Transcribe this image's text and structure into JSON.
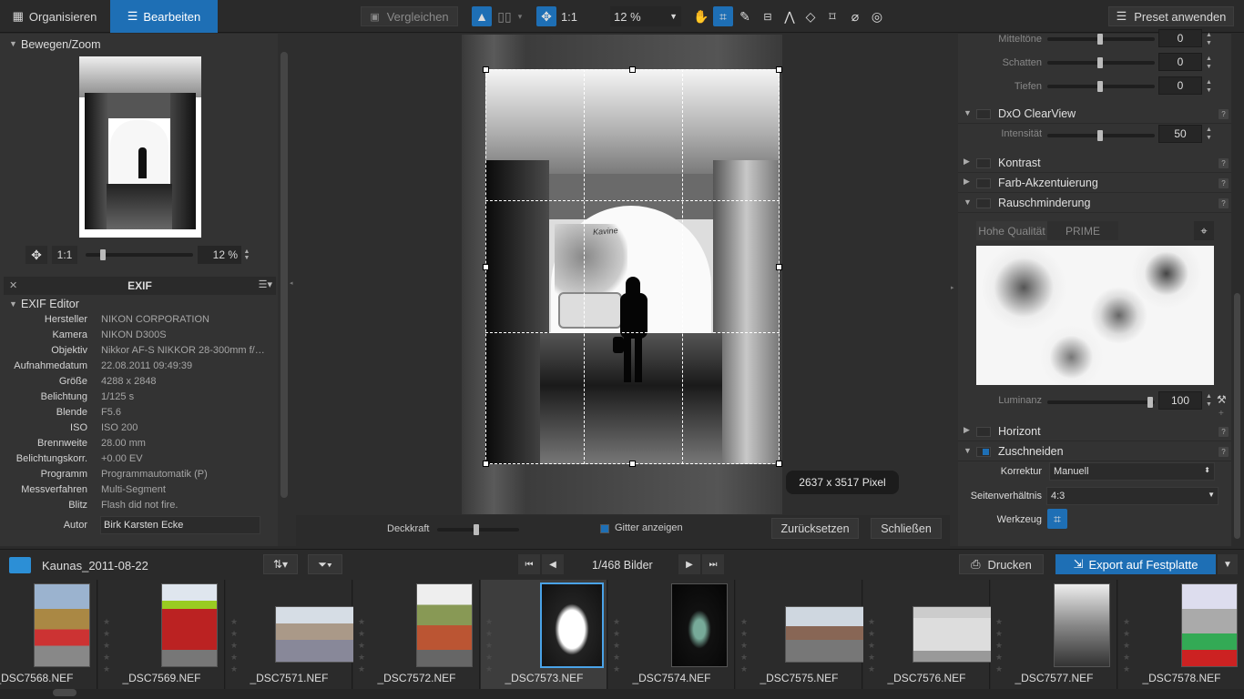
{
  "topbar": {
    "tab_organize": "Organisieren",
    "tab_edit": "Bearbeiten",
    "compare": "Vergleichen",
    "fit_label": "1:1",
    "zoom": "12 %",
    "preset": "Preset anwenden"
  },
  "left": {
    "navigator_title": "Bewegen/Zoom",
    "nav_fit": "1:1",
    "nav_zoom": "12 %",
    "exif_header": "EXIF",
    "exif_editor": "EXIF Editor",
    "exif": [
      {
        "k": "Hersteller",
        "v": "NIKON CORPORATION"
      },
      {
        "k": "Kamera",
        "v": "NIKON D300S"
      },
      {
        "k": "Objektiv",
        "v": "Nikkor AF-S NIKKOR 28-300mm f/…"
      },
      {
        "k": "Aufnahmedatum",
        "v": "22.08.2011 09:49:39"
      },
      {
        "k": "Größe",
        "v": "4288 x 2848"
      },
      {
        "k": "Belichtung",
        "v": "1/125 s"
      },
      {
        "k": "Blende",
        "v": "F5.6"
      },
      {
        "k": "ISO",
        "v": "ISO 200"
      },
      {
        "k": "Brennweite",
        "v": "28.00 mm"
      },
      {
        "k": "Belichtungskorr.",
        "v": "+0.00 EV"
      },
      {
        "k": "Programm",
        "v": "Programmautomatik (P)"
      },
      {
        "k": "Messverfahren",
        "v": "Multi-Segment"
      },
      {
        "k": "Blitz",
        "v": "Flash did not fire."
      }
    ],
    "author_label": "Autor",
    "author_value": "Birk Karsten Ecke"
  },
  "center": {
    "size_tooltip": "2637 x 3517 Pixel",
    "opacity_label": "Deckkraft",
    "grid_label": "Gitter anzeigen",
    "reset": "Zurücksetzen",
    "close": "Schließen",
    "photo_text": "Kavine"
  },
  "right": {
    "tone_rows": [
      {
        "label": "Mitteltöne",
        "value": "0"
      },
      {
        "label": "Schatten",
        "value": "0"
      },
      {
        "label": "Tiefen",
        "value": "0"
      }
    ],
    "clearview": "DxO ClearView",
    "intensity_label": "Intensität",
    "intensity_value": "50",
    "contrast": "Kontrast",
    "color_accent": "Farb-Akzentuierung",
    "noise": "Rauschminderung",
    "quality_high": "Hohe Qualität",
    "quality_prime": "PRIME",
    "luminance_label": "Luminanz",
    "luminance_value": "100",
    "horizon": "Horizont",
    "crop": "Zuschneiden",
    "correction_label": "Korrektur",
    "correction_value": "Manuell",
    "ratio_label": "Seitenverhältnis",
    "ratio_value": "4:3",
    "tool_label": "Werkzeug"
  },
  "bottom": {
    "folder": "Kaunas_2011-08-22",
    "counter": "1/468 Bilder",
    "print": "Drucken",
    "export": "Export auf Festplatte"
  },
  "filmstrip": [
    {
      "name": "_DSC7568.NEF"
    },
    {
      "name": "_DSC7569.NEF"
    },
    {
      "name": "_DSC7571.NEF"
    },
    {
      "name": "_DSC7572.NEF"
    },
    {
      "name": "_DSC7573.NEF"
    },
    {
      "name": "_DSC7574.NEF"
    },
    {
      "name": "_DSC7575.NEF"
    },
    {
      "name": "_DSC7576.NEF"
    },
    {
      "name": "_DSC7577.NEF"
    },
    {
      "name": "_DSC7578.NEF"
    }
  ],
  "colors": {
    "accent": "#1e6fb5",
    "background": "#2b2b2b",
    "panel": "#333333"
  }
}
